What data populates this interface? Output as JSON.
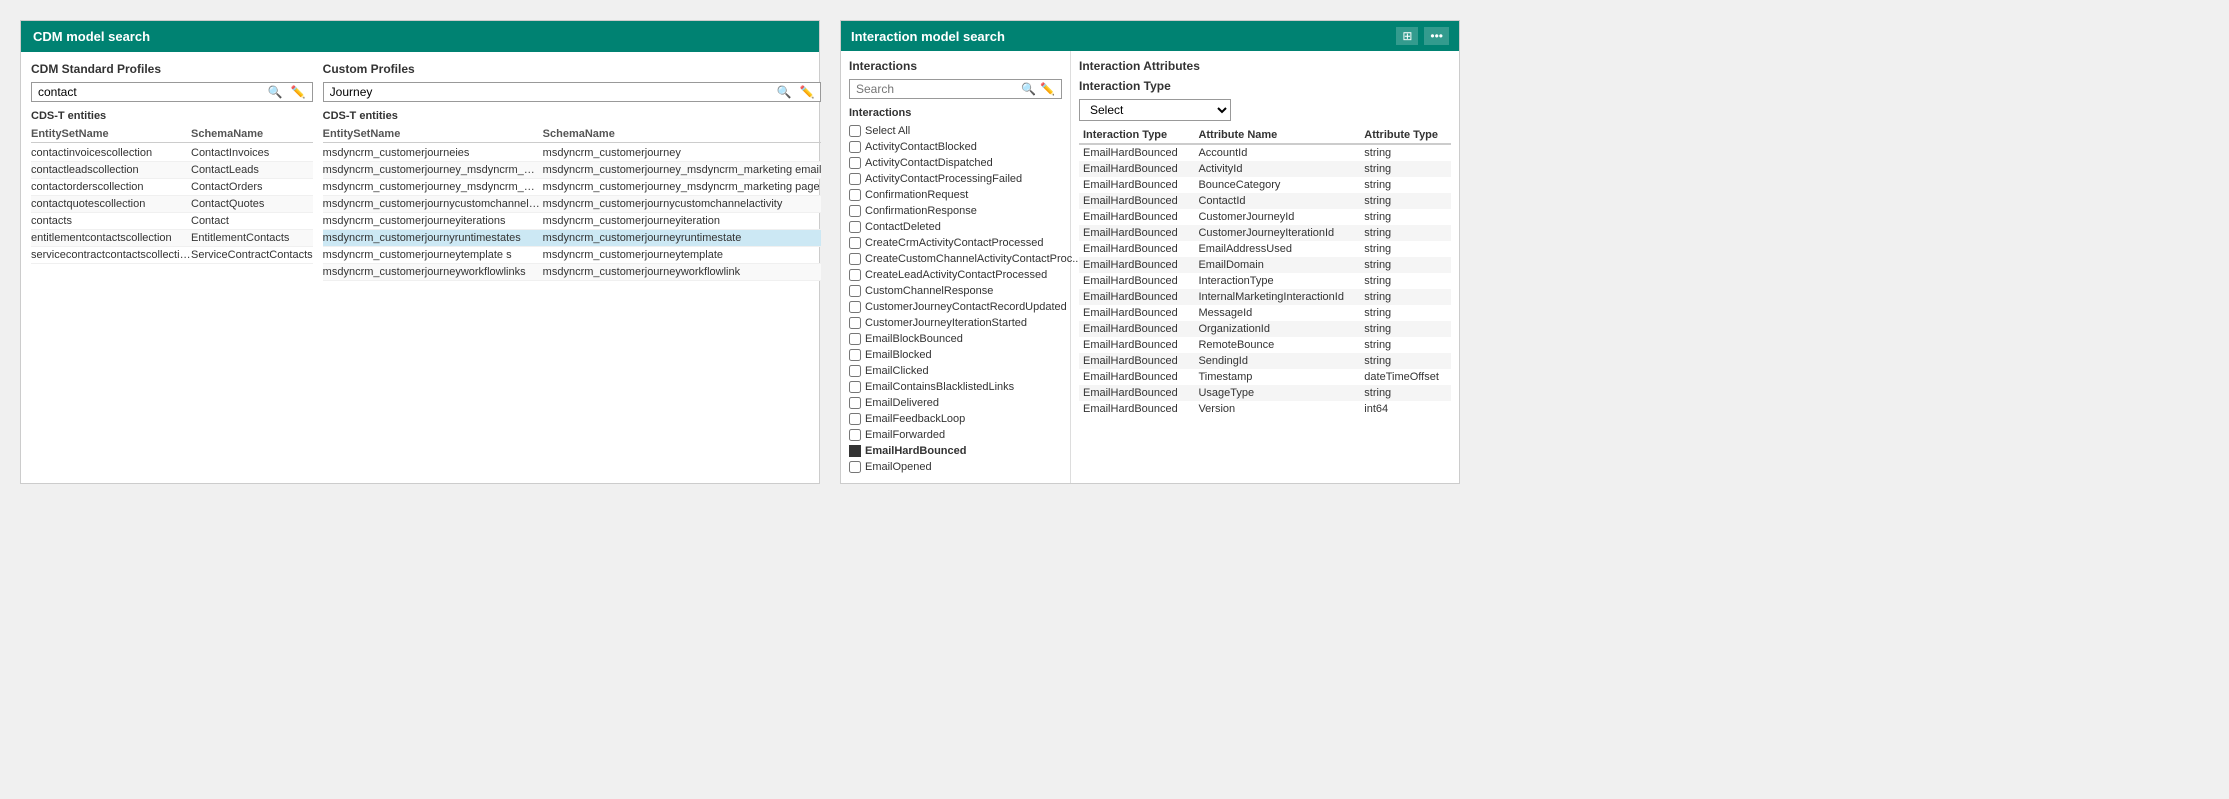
{
  "cdm_panel": {
    "title": "CDM model search",
    "left_section": {
      "title": "CDM Standard Profiles",
      "search_value": "contact",
      "cds_label": "CDS-T entities",
      "col1": "EntitySetName",
      "col2": "SchemaName",
      "rows": [
        {
          "entity": "contactinvoicescollection",
          "schema": "ContactInvoices"
        },
        {
          "entity": "contactleadscollection",
          "schema": "ContactLeads"
        },
        {
          "entity": "contactorderscollection",
          "schema": "ContactOrders"
        },
        {
          "entity": "contactquotescollection",
          "schema": "ContactQuotes"
        },
        {
          "entity": "contacts",
          "schema": "Contact"
        },
        {
          "entity": "entitlementcontactscollection",
          "schema": "EntitlementContacts"
        },
        {
          "entity": "servicecontractcontactscollection",
          "schema": "ServiceContractContacts"
        }
      ]
    },
    "right_section": {
      "title": "Custom Profiles",
      "search_value": "Journey",
      "cds_label": "CDS-T entities",
      "col1": "EntitySetName",
      "col2": "SchemaName",
      "rows": [
        {
          "entity": "msdyncrm_customerjourneies",
          "schema": "msdyncrm_customerjourney",
          "selected": false
        },
        {
          "entity": "msdyncrm_customerjourney_msdyncrm_marketi ngmailset",
          "schema": "msdyncrm_customerjourney_msdyncrm_marketing email",
          "selected": false
        },
        {
          "entity": "msdyncrm_customerjourney_msdyncrm_marketi ngpageset",
          "schema": "msdyncrm_customerjourney_msdyncrm_marketing page",
          "selected": false
        },
        {
          "entity": "msdyncrm_customerjournycustomchannelactivities",
          "schema": "msdyncrm_customerjournycustomchannelactivity",
          "selected": false
        },
        {
          "entity": "msdyncrm_customerjourneyiterations",
          "schema": "msdyncrm_customerjourneyiteration",
          "selected": false
        },
        {
          "entity": "msdyncrm_customerjournyruntimestates",
          "schema": "msdyncrm_customerjourneyruntimestate",
          "selected": true
        },
        {
          "entity": "msdyncrm_customerjourneytemplate s",
          "schema": "msdyncrm_customerjourneytemplate",
          "selected": false
        },
        {
          "entity": "msdyncrm_customerjourneyworkflowlinks",
          "schema": "msdyncrm_customerjourneyworkflowlink",
          "selected": false
        }
      ]
    }
  },
  "interaction_panel": {
    "title": "Interaction model search",
    "left_pane": {
      "title": "Interactions",
      "search_placeholder": "Search",
      "interactions_label": "Interactions",
      "items": [
        {
          "label": "Select All",
          "checked": false,
          "filled": false
        },
        {
          "label": "ActivityContactBlocked",
          "checked": false,
          "filled": false
        },
        {
          "label": "ActivityContactDispatched",
          "checked": false,
          "filled": false
        },
        {
          "label": "ActivityContactProcessingFailed",
          "checked": false,
          "filled": false
        },
        {
          "label": "ConfirmationRequest",
          "checked": false,
          "filled": false
        },
        {
          "label": "ConfirmationResponse",
          "checked": false,
          "filled": false
        },
        {
          "label": "ContactDeleted",
          "checked": false,
          "filled": false
        },
        {
          "label": "CreateCrmActivityContactProcessed",
          "checked": false,
          "filled": false
        },
        {
          "label": "CreateCustomChannelActivityContactProc...",
          "checked": false,
          "filled": false
        },
        {
          "label": "CreateLeadActivityContactProcessed",
          "checked": false,
          "filled": false
        },
        {
          "label": "CustomChannelResponse",
          "checked": false,
          "filled": false
        },
        {
          "label": "CustomerJourneyContactRecordUpdated",
          "checked": false,
          "filled": false
        },
        {
          "label": "CustomerJourneyIterationStarted",
          "checked": false,
          "filled": false
        },
        {
          "label": "EmailBlockBounced",
          "checked": false,
          "filled": false
        },
        {
          "label": "EmailBlocked",
          "checked": false,
          "filled": false
        },
        {
          "label": "EmailClicked",
          "checked": false,
          "filled": false
        },
        {
          "label": "EmailContainsBlacklistedLinks",
          "checked": false,
          "filled": false
        },
        {
          "label": "EmailDelivered",
          "checked": false,
          "filled": false
        },
        {
          "label": "EmailFeedbackLoop",
          "checked": false,
          "filled": false
        },
        {
          "label": "EmailForwarded",
          "checked": false,
          "filled": false
        },
        {
          "label": "EmailHardBounced",
          "checked": false,
          "filled": true
        },
        {
          "label": "EmailOpened",
          "checked": false,
          "filled": false
        }
      ]
    },
    "right_pane": {
      "title": "Interaction Attributes",
      "filter_label": "Interaction Type",
      "filter_value": "Select",
      "col1": "Interaction Type",
      "col2": "Attribute Name",
      "col3": "Attribute Type",
      "rows": [
        {
          "itype": "EmailHardBounced",
          "aname": "AccountId",
          "atype": "string"
        },
        {
          "itype": "EmailHardBounced",
          "aname": "ActivityId",
          "atype": "string"
        },
        {
          "itype": "EmailHardBounced",
          "aname": "BounceCategory",
          "atype": "string"
        },
        {
          "itype": "EmailHardBounced",
          "aname": "ContactId",
          "atype": "string"
        },
        {
          "itype": "EmailHardBounced",
          "aname": "CustomerJourneyId",
          "atype": "string"
        },
        {
          "itype": "EmailHardBounced",
          "aname": "CustomerJourneyIterationId",
          "atype": "string"
        },
        {
          "itype": "EmailHardBounced",
          "aname": "EmailAddressUsed",
          "atype": "string"
        },
        {
          "itype": "EmailHardBounced",
          "aname": "EmailDomain",
          "atype": "string"
        },
        {
          "itype": "EmailHardBounced",
          "aname": "InteractionType",
          "atype": "string"
        },
        {
          "itype": "EmailHardBounced",
          "aname": "InternalMarketingInteractionId",
          "atype": "string"
        },
        {
          "itype": "EmailHardBounced",
          "aname": "MessageId",
          "atype": "string"
        },
        {
          "itype": "EmailHardBounced",
          "aname": "OrganizationId",
          "atype": "string"
        },
        {
          "itype": "EmailHardBounced",
          "aname": "RemoteBounce",
          "atype": "string"
        },
        {
          "itype": "EmailHardBounced",
          "aname": "SendingId",
          "atype": "string"
        },
        {
          "itype": "EmailHardBounced",
          "aname": "Timestamp",
          "atype": "dateTimeOffset"
        },
        {
          "itype": "EmailHardBounced",
          "aname": "UsageType",
          "atype": "string"
        },
        {
          "itype": "EmailHardBounced",
          "aname": "Version",
          "atype": "int64"
        }
      ]
    }
  }
}
